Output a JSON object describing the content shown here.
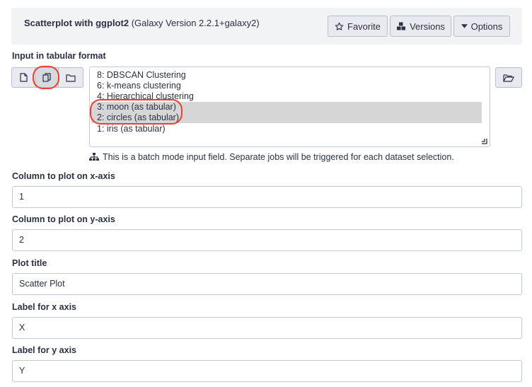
{
  "header": {
    "tool_name": "Scatterplot with ggplot2",
    "version": "(Galaxy Version 2.2.1+galaxy2)",
    "favorite_label": "Favorite",
    "versions_label": "Versions",
    "options_label": "Options"
  },
  "input": {
    "label": "Input in tabular format",
    "options": [
      {
        "label": "8: DBSCAN Clustering",
        "selected": false
      },
      {
        "label": "6: k-means clustering",
        "selected": false
      },
      {
        "label": "4: Hierarchical clustering",
        "selected": false
      },
      {
        "label": "3: moon (as tabular)",
        "selected": true
      },
      {
        "label": "2: circles (as tabular)",
        "selected": true
      },
      {
        "label": "1: iris (as tabular)",
        "selected": false
      }
    ],
    "batch_note": "This is a batch mode input field. Separate jobs will be triggered for each dataset selection."
  },
  "fields": [
    {
      "label": "Column to plot on x-axis",
      "value": "1"
    },
    {
      "label": "Column to plot on y-axis",
      "value": "2"
    },
    {
      "label": "Plot title",
      "value": "Scatter Plot"
    },
    {
      "label": "Label for x axis",
      "value": "X"
    },
    {
      "label": "Label for y axis",
      "value": "Y"
    }
  ],
  "colors": {
    "highlight_circle": "#e8412f",
    "selected_option": "#d6d6d6"
  }
}
